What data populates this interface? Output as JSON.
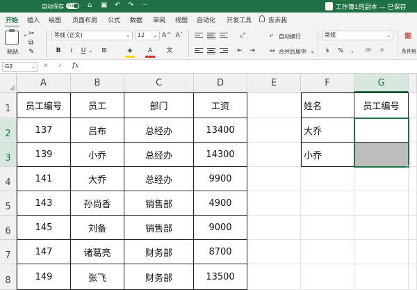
{
  "titlebar": {
    "autosave_label": "自动保存",
    "autosave_state": "开启",
    "document_title": "工作簿1的副本 — 已保存",
    "bg_color": "#1f7145"
  },
  "tabs": [
    {
      "label": "开始",
      "active": true
    },
    {
      "label": "插入"
    },
    {
      "label": "绘图"
    },
    {
      "label": "页面布局"
    },
    {
      "label": "公式"
    },
    {
      "label": "数据"
    },
    {
      "label": "审阅"
    },
    {
      "label": "视图"
    },
    {
      "label": "自动化"
    },
    {
      "label": "开发工具"
    },
    {
      "label": "告诉我"
    }
  ],
  "ribbon": {
    "paste_label": "粘贴",
    "font_name": "等线 (正文)",
    "font_size": "12",
    "increase_font": "A^",
    "decrease_font": "Aˇ",
    "bold": "B",
    "italic": "I",
    "underline": "U",
    "wrap_text_label": "自动换行",
    "merge_center_label": "合并后居中",
    "number_format": "常规",
    "conditional_format_label": "条件格",
    "font_color": "#d32f2f",
    "fill_color": "#ffd800"
  },
  "formula_bar": {
    "name_box": "G2",
    "fx_label": "fx",
    "formula": ""
  },
  "sheet": {
    "columns": [
      "A",
      "B",
      "C",
      "D",
      "E",
      "F",
      "G"
    ],
    "selected_column": "G",
    "rows": [
      "1",
      "2",
      "3",
      "4",
      "5",
      "6",
      "7",
      "8"
    ],
    "selected_rows": [
      "2",
      "3"
    ],
    "headers": [
      "员工编号",
      "员工",
      "部门",
      "工资"
    ],
    "records": [
      [
        "137",
        "吕布",
        "总经办",
        "13400"
      ],
      [
        "139",
        "小乔",
        "总经办",
        "14300"
      ],
      [
        "141",
        "大乔",
        "总经办",
        "9900"
      ],
      [
        "143",
        "孙尚香",
        "销售部",
        "4900"
      ],
      [
        "145",
        "刘备",
        "销售部",
        "9000"
      ],
      [
        "147",
        "诸葛亮",
        "财务部",
        "8700"
      ],
      [
        "149",
        "张飞",
        "财务部",
        "13500"
      ]
    ],
    "lookup": {
      "header_name": "姓名",
      "header_id": "员工编号",
      "names": [
        "大乔",
        "小乔"
      ]
    },
    "selection_color": "#1f7145"
  }
}
